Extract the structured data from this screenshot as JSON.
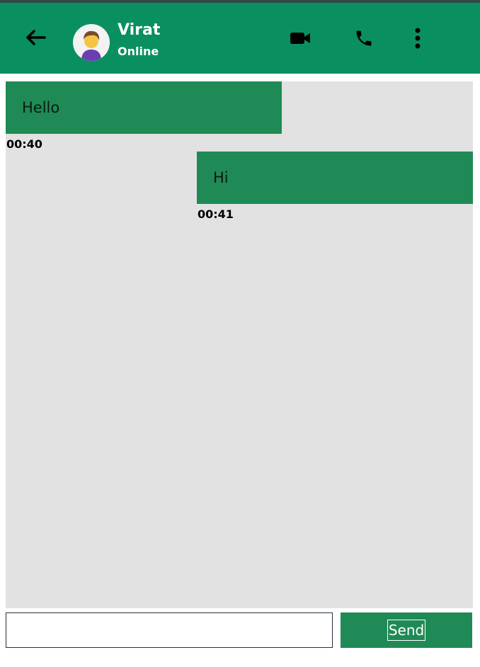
{
  "header": {
    "contact_name": "Virat",
    "contact_status": "Online",
    "back_icon": "arrow-left-icon",
    "video_icon": "video-camera-icon",
    "call_icon": "phone-icon",
    "menu_icon": "more-vertical-icon",
    "background_color": "#0a9060"
  },
  "messages": [
    {
      "text": "Hello",
      "time": "00:40",
      "side": "left"
    },
    {
      "text": "Hi",
      "time": "00:41",
      "side": "right"
    }
  ],
  "composer": {
    "input_value": "",
    "send_label": "Send"
  },
  "colors": {
    "bubble": "#1f8a55",
    "chat_background": "#e2e2e2",
    "text_on_accent": "#ffffff"
  }
}
